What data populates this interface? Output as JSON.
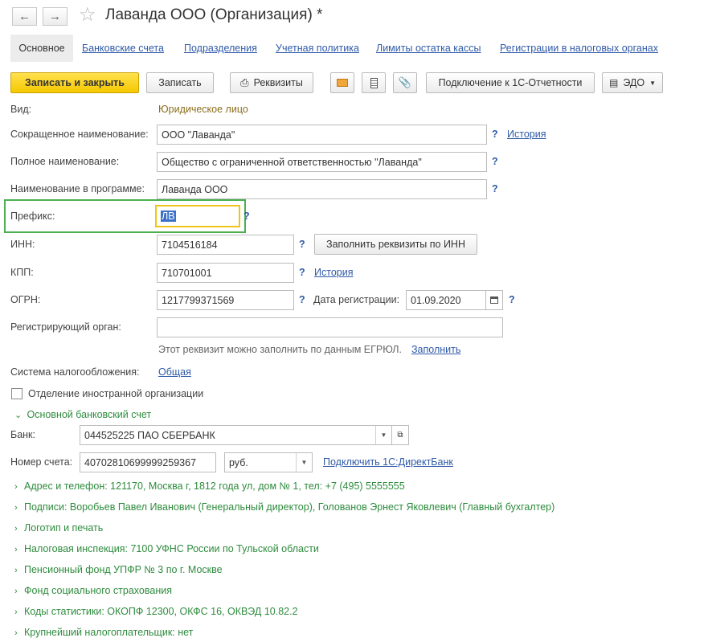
{
  "header": {
    "title": "Лаванда ООО (Организация) *"
  },
  "tabs": [
    {
      "label": "Основное"
    },
    {
      "label": "Банковские счета"
    },
    {
      "label": "Подразделения"
    },
    {
      "label": "Учетная политика"
    },
    {
      "label": "Лимиты остатка кассы"
    },
    {
      "label": "Регистрации в налоговых органах"
    }
  ],
  "toolbar": {
    "save_close": "Записать и закрыть",
    "save": "Записать",
    "requisites": "Реквизиты",
    "connect_1c": "Подключение к 1С-Отчетности",
    "edo": "ЭДО"
  },
  "form": {
    "vid_label": "Вид:",
    "vid_value": "Юридическое лицо",
    "short_name_label": "Сокращенное наименование:",
    "short_name_value": "ООО \"Лаванда\"",
    "full_name_label": "Полное наименование:",
    "full_name_value": "Общество с ограниченной ответственностью \"Лаванда\"",
    "program_name_label": "Наименование в программе:",
    "program_name_value": "Лаванда ООО",
    "prefix_label": "Префикс:",
    "prefix_value": "ЛВ",
    "inn_label": "ИНН:",
    "inn_value": "7104516184",
    "fill_by_inn": "Заполнить реквизиты по ИНН",
    "kpp_label": "КПП:",
    "kpp_value": "710701001",
    "ogrn_label": "ОГРН:",
    "ogrn_value": "1217799371569",
    "reg_date_label": "Дата регистрации:",
    "reg_date_value": "01.09.2020",
    "reg_org_label": "Регистрирующий орган:",
    "reg_org_value": "",
    "egrul_hint": "Этот реквизит можно заполнить по данным ЕГРЮЛ.",
    "fill_link": "Заполнить",
    "tax_system_label": "Система налогообложения:",
    "tax_system_value": "Общая",
    "foreign_branch_label": "Отделение иностранной организации",
    "history_link": "История",
    "help": "?"
  },
  "bank": {
    "section_label": "Основной банковский счет",
    "bank_label": "Банк:",
    "bank_value": "044525225 ПАО СБЕРБАНК",
    "account_label": "Номер счета:",
    "account_value": "40702810699999259367",
    "currency_value": "руб.",
    "direct_bank_link": "Подключить 1С:ДиректБанк"
  },
  "sections": [
    {
      "label": "Адрес и телефон: 121170, Москва г, 1812 года ул, дом № 1, тел: +7 (495) 5555555"
    },
    {
      "label": "Подписи: Воробьев Павел Иванович (Генеральный директор), Голованов Эрнест Яковлевич (Главный бухгалтер)"
    },
    {
      "label": "Логотип и печать"
    },
    {
      "label": "Налоговая инспекция: 7100 УФНС России по Тульской области"
    },
    {
      "label": "Пенсионный фонд УПФР № 3 по г. Москве"
    },
    {
      "label": "Фонд социального страхования"
    },
    {
      "label": "Коды статистики: ОКОПФ 12300, ОКФС 16, ОКВЭД 10.82.2"
    },
    {
      "label": "Крупнейший налогоплательщик: нет"
    }
  ],
  "colors": {
    "accent_yellow": "#f5c800",
    "highlight_green": "#4caf50",
    "link_blue": "#2f5aa8",
    "section_green": "#2e8b3d"
  }
}
